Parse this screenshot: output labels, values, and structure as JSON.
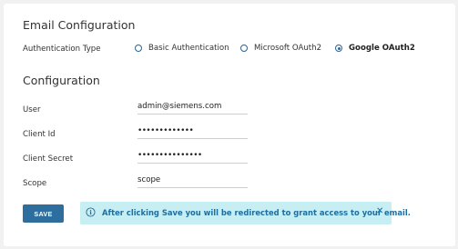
{
  "email_config": {
    "title": "Email Configuration",
    "auth_type_label": "Authentication Type",
    "auth_options": [
      {
        "label": "Basic Authentication",
        "selected": false
      },
      {
        "label": "Microsoft OAuth2",
        "selected": false
      },
      {
        "label": "Google OAuth2",
        "selected": true
      }
    ]
  },
  "configuration": {
    "title": "Configuration",
    "user_label": "User",
    "user_value": "admin@siemens.com",
    "client_id_label": "Client Id",
    "client_id_value": "•••••••••••••",
    "client_secret_label": "Client Secret",
    "client_secret_value": "•••••••••••••••",
    "scope_label": "Scope",
    "scope_value": "scope"
  },
  "actions": {
    "save_label": "SAVE"
  },
  "alert": {
    "message": "After clicking Save you will be redirected to grant access to your email.",
    "close_symbol": "✕",
    "info_symbol": "i"
  },
  "colors": {
    "primary": "#2e6e9e",
    "alert_bg": "#c6eef3",
    "alert_text": "#1e6fa0"
  }
}
